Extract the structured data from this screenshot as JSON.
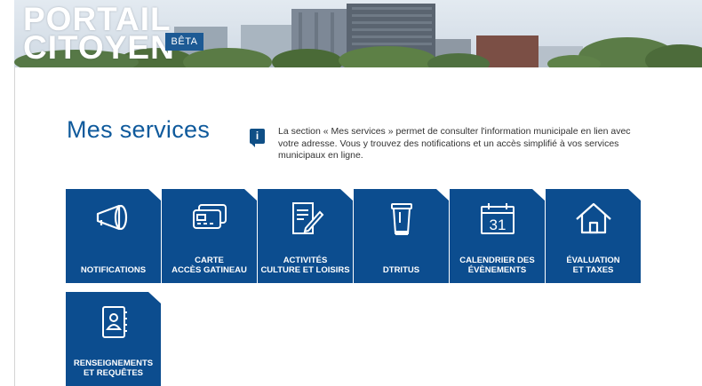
{
  "header": {
    "logo_line1": "PORTAIL",
    "logo_line2": "CITOYEN",
    "badge": "BÊTA"
  },
  "main": {
    "title": "Mes services",
    "info_icon_glyph": "i",
    "info_text": "La section « Mes services » permet de consulter l'information municipale en lien avec votre adresse. Vous y trouvez des notifications et un accès simplifié à vos services municipaux en ligne."
  },
  "services": [
    {
      "label": "NOTIFICATIONS",
      "icon": "megaphone-icon"
    },
    {
      "label": "CARTE\nACCÈS GATINEAU",
      "icon": "card-icon"
    },
    {
      "label": "ACTIVITÉS\nCULTURE ET LOISIRS",
      "icon": "document-pencil-icon"
    },
    {
      "label": "DTRITUS",
      "icon": "trash-bin-icon"
    },
    {
      "label": "CALENDRIER DES\nÉVÈNEMENTS",
      "icon": "calendar-icon",
      "calendar_day": "31"
    },
    {
      "label": "ÉVALUATION\nET TAXES",
      "icon": "house-icon"
    },
    {
      "label": "RENSEIGNEMENTS\nET REQUÊTES",
      "icon": "contact-book-icon"
    }
  ],
  "colors": {
    "tile": "#0c4d8f",
    "title": "#0f5a9c",
    "badge": "#1d5a94"
  }
}
